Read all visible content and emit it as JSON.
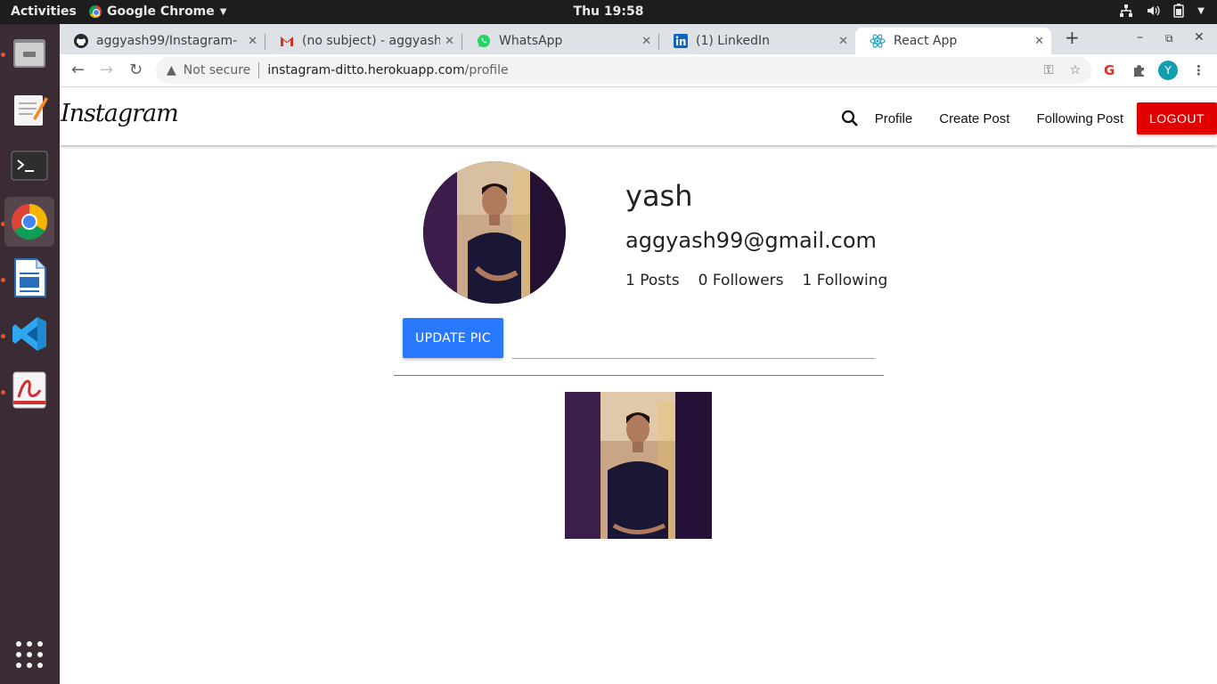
{
  "system": {
    "activities": "Activities",
    "app_name": "Google Chrome",
    "clock": "Thu 19:58"
  },
  "dock": {
    "items": [
      "file-manager",
      "text-editor",
      "terminal",
      "chrome",
      "writer",
      "vscode",
      "pdf-viewer"
    ],
    "active": "chrome"
  },
  "browser": {
    "tabs": [
      {
        "title": "aggyash99/Instagram-",
        "icon": "github-icon"
      },
      {
        "title": "(no subject) - aggyash9",
        "icon": "gmail-icon"
      },
      {
        "title": "WhatsApp",
        "icon": "whatsapp-icon"
      },
      {
        "title": "(1) LinkedIn",
        "icon": "linkedin-icon"
      },
      {
        "title": "React App",
        "icon": "react-icon",
        "active": true
      }
    ],
    "security": "Not secure",
    "url_host": "instagram-ditto.herokuapp.com",
    "url_path": "/profile",
    "profile_initial": "Y"
  },
  "app": {
    "brand": "Instagram",
    "nav": {
      "profile": "Profile",
      "create_post": "Create Post",
      "following_post": "Following Post",
      "logout": "LOGOUT"
    },
    "profile": {
      "name": "yash",
      "email": "aggyash99@gmail.com",
      "posts": "1 Posts",
      "followers": "0 Followers",
      "following": "1 Following",
      "update_pic": "UPDATE PIC"
    }
  },
  "colors": {
    "logout": "#e00000",
    "update_btn": "#2979ff",
    "dock_bg": "#3b2b34",
    "accent": "#e95420"
  }
}
